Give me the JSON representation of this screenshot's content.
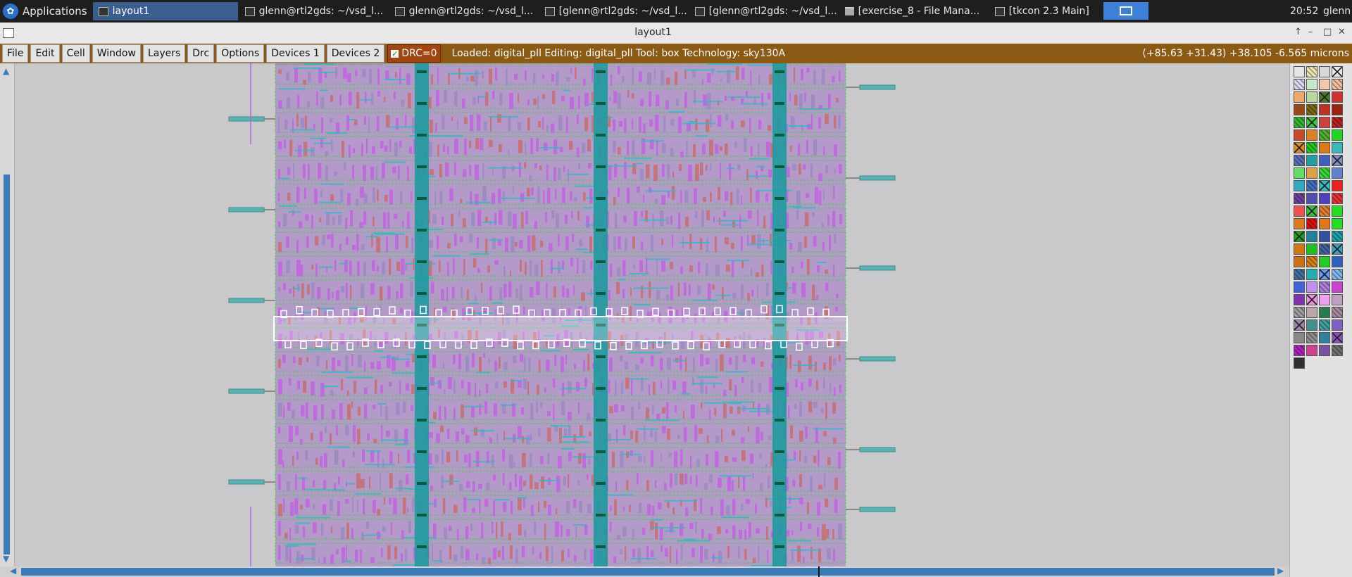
{
  "taskbar": {
    "apps_label": "Applications",
    "tasks": [
      {
        "label": "layout1",
        "active": true,
        "icon": "window-icon"
      },
      {
        "label": "glenn@rtl2gds: ~/vsd_l...",
        "active": false,
        "icon": "terminal-icon"
      },
      {
        "label": "glenn@rtl2gds: ~/vsd_l...",
        "active": false,
        "icon": "terminal-icon"
      },
      {
        "label": "[glenn@rtl2gds: ~/vsd_l...",
        "active": false,
        "icon": "terminal-icon"
      },
      {
        "label": "[glenn@rtl2gds: ~/vsd_l...",
        "active": false,
        "icon": "terminal-icon"
      },
      {
        "label": "[exercise_8 - File Mana...",
        "active": false,
        "icon": "folder-icon"
      },
      {
        "label": "[tkcon 2.3 Main]",
        "active": false,
        "icon": "window-icon"
      }
    ],
    "clock": "20:52",
    "user": "glenn"
  },
  "window": {
    "title": "layout1"
  },
  "menubar": {
    "items": [
      "File",
      "Edit",
      "Cell",
      "Window",
      "Layers",
      "Drc",
      "Options",
      "Devices 1",
      "Devices 2"
    ],
    "drc_label": "DRC=0",
    "status": "Loaded: digital_pll Editing: digital_pll Tool: box  Technology: sky130A",
    "coords": "(+85.63 +31.43) +38.105 -6.565 microns"
  },
  "colors": {
    "menubar_bg": "#8b5a14",
    "canvas_bg": "#c9c9cc",
    "metal_cyan": "#2fb8c4",
    "poly_magenta": "#c060e0",
    "diffusion_green": "#3cd23c",
    "stripe_teal": "#1e9aa0",
    "accent_blue": "#3d7ab8"
  },
  "palette": {
    "swatches": [
      "#e6e6e6",
      "#f0e6b4",
      "#d8d8d8",
      "#e8e8e8",
      "#e0d8f0",
      "#c8e8c8",
      "#f0c8b0",
      "#f4c0a0",
      "#f0a868",
      "#b8d8a0",
      "#4a7a20",
      "#d83030",
      "#9a4a10",
      "#7a6a10",
      "#c03020",
      "#a02010",
      "#30b830",
      "#40c840",
      "#d04040",
      "#c02020",
      "#c84a20",
      "#e08020",
      "#50b030",
      "#20d820",
      "#e08a20",
      "#20c820",
      "#e07818",
      "#38b8b8",
      "#5870b8",
      "#20a0a0",
      "#4060c0",
      "#8090c0",
      "#60e060",
      "#e0a040",
      "#30e030",
      "#6080d0",
      "#30a8c8",
      "#4070c0",
      "#30c0c0",
      "#f02020",
      "#7040a0",
      "#5050b0",
      "#5040c0",
      "#f03030",
      "#f05050",
      "#30c030",
      "#e08028",
      "#20e020",
      "#e07820",
      "#e01010",
      "#e07818",
      "#20e020",
      "#20a020",
      "#2080a0",
      "#3050a0",
      "#20a0b0",
      "#d07810",
      "#20c020",
      "#4060a0",
      "#40a0c0",
      "#d07010",
      "#e08010",
      "#20d020",
      "#3060c0",
      "#4070a0",
      "#20b0b0",
      "#60a0f0",
      "#80b8f0",
      "#4060e0",
      "#c090f0",
      "#b080e0",
      "#d040d0",
      "#8030b0",
      "#f090e0",
      "#f0a0f0",
      "#c0a0c0",
      "#a0a0a0",
      "#b8a8a8",
      "#2a7a50",
      "#a888a0",
      "#a080b0",
      "#409090",
      "#40a0a0",
      "#8060c0",
      "#888888",
      "#909090",
      "#3080a0",
      "#9050c0",
      "#b020c0",
      "#d04090",
      "#8050a0",
      "#707070",
      "#303030"
    ]
  }
}
